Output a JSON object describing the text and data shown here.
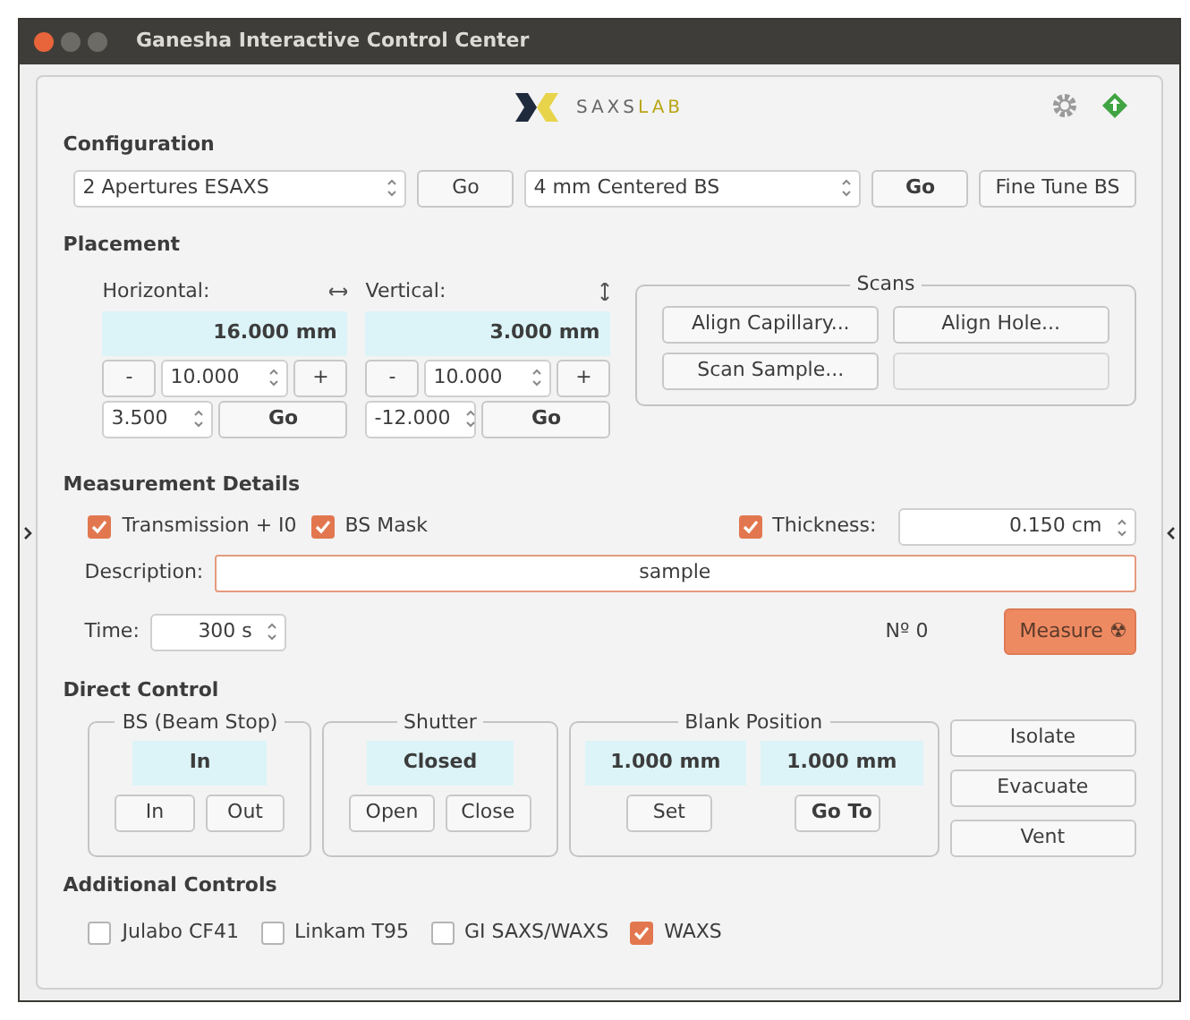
{
  "window": {
    "title": "Ganesha Interactive Control Center"
  },
  "logo": {
    "text_1": "SAXS",
    "text_2": "LAB"
  },
  "configuration": {
    "heading": "Configuration",
    "aperture_select": "2 Apertures ESAXS",
    "go_1": "Go",
    "beamstop_select": "4 mm Centered BS",
    "go_2": "Go",
    "fine_tune": "Fine Tune BS"
  },
  "placement": {
    "heading": "Placement",
    "axes": [
      {
        "kind": "horizontal",
        "label": "Horizontal:",
        "readout": "16.000 mm",
        "minus": "-",
        "step": "10.000",
        "plus": "+",
        "target": "3.500",
        "go": "Go"
      },
      {
        "kind": "vertical",
        "label": "Vertical:",
        "readout": "3.000 mm",
        "minus": "-",
        "step": "10.000",
        "plus": "+",
        "target": "-12.000",
        "go": "Go"
      }
    ],
    "scans": {
      "title": "Scans",
      "buttons": [
        "Align Capillary...",
        "Align Hole...",
        "Scan Sample..."
      ]
    }
  },
  "measurement": {
    "heading": "Measurement Details",
    "options": [
      {
        "label": "Transmission + I0",
        "checked": true
      },
      {
        "label": "BS Mask",
        "checked": true
      }
    ],
    "thickness": {
      "label": "Thickness:",
      "checked": true,
      "value": "0.150 cm"
    },
    "description": {
      "label": "Description:",
      "value": "sample"
    },
    "time": {
      "label": "Time:",
      "value": "300 s"
    },
    "count": "Nº 0",
    "measure": "Measure ☢"
  },
  "direct_control": {
    "heading": "Direct Control",
    "beam_stop": {
      "title": "BS (Beam Stop)",
      "state": "In",
      "buttons": [
        "In",
        "Out"
      ]
    },
    "shutter": {
      "title": "Shutter",
      "state": "Closed",
      "buttons": [
        "Open",
        "Close"
      ]
    },
    "blank_position": {
      "title": "Blank Position",
      "values": [
        "1.000 mm",
        "1.000 mm"
      ],
      "buttons": [
        "Set",
        "Go To"
      ]
    },
    "actions": [
      "Isolate",
      "Evacuate",
      "Vent"
    ]
  },
  "additional": {
    "heading": "Additional Controls",
    "options": [
      {
        "label": "Julabo CF41",
        "checked": false
      },
      {
        "label": "Linkam T95",
        "checked": false
      },
      {
        "label": "GI SAXS/WAXS",
        "checked": false
      },
      {
        "label": "WAXS",
        "checked": true
      }
    ]
  }
}
